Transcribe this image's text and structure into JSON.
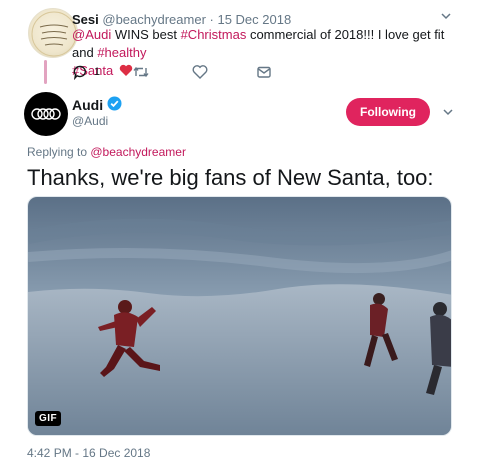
{
  "parent_tweet": {
    "author_name": "Sesi",
    "handle": "@beachydreamer",
    "date": "· 15 Dec 2018",
    "text_parts": {
      "mention": "@Audi",
      "t1": " WINS best ",
      "tag_christmas": "#Christmas",
      "t2": " commercial of 2018!!! I love get fit and ",
      "tag_healthy": "#healthy",
      "tag_santa": "#Santa"
    },
    "avatar_text": "The Beach is my happy place",
    "reply_count": "1"
  },
  "tweet": {
    "author_name": "Audi",
    "handle": "@Audi",
    "follow_label": "Following",
    "replying_prefix": "Replying to ",
    "replying_to": "@beachydreamer",
    "text": "Thanks, we're big fans of New Santa, too:",
    "media_badge": "GIF",
    "timestamp": "4:42 PM - 16 Dec 2018"
  },
  "icons": [
    "reply-icon",
    "retweet-icon",
    "like-icon",
    "dm-icon",
    "chevron-down-icon",
    "verified-icon",
    "heart-emoji-icon",
    "audi-rings-logo"
  ],
  "colors": {
    "accent": "#e0245e",
    "link": "#c2185b",
    "muted": "#657786",
    "verified": "#1da1f2",
    "thread_line": "#e2a3c0"
  }
}
